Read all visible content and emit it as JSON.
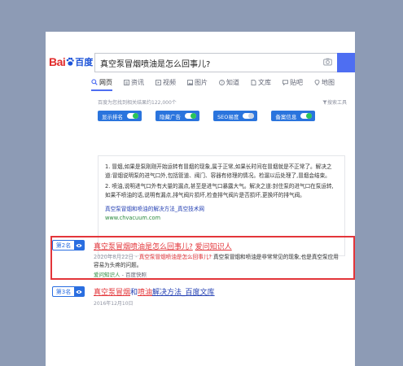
{
  "logo": {
    "part1": "Bai",
    "part2": "百度"
  },
  "search": {
    "query": "真空泵冒烟喷油是怎么回事儿?"
  },
  "tabs": [
    {
      "label": "网页",
      "icon": "search-icon",
      "active": true
    },
    {
      "label": "资讯",
      "icon": "news-icon"
    },
    {
      "label": "视频",
      "icon": "video-icon"
    },
    {
      "label": "图片",
      "icon": "image-icon"
    },
    {
      "label": "知道",
      "icon": "question-icon"
    },
    {
      "label": "文库",
      "icon": "document-icon"
    },
    {
      "label": "贴吧",
      "icon": "forum-icon"
    },
    {
      "label": "地图",
      "icon": "map-icon"
    }
  ],
  "meta": {
    "results_text": "百度为您找到相关结果约122,000个",
    "tools_label": "搜索工具"
  },
  "toggles": [
    {
      "label": "显示排名",
      "state": "on"
    },
    {
      "label": "隐藏广告",
      "state": "on"
    },
    {
      "label": "SEO易度",
      "state": "off"
    },
    {
      "label": "备案信息",
      "state": "on"
    }
  ],
  "answer_card": {
    "point1": "1. 冒烟,如果是泵刚刚开始运转有冒烟的现象,属于正常,如果长时间在冒烟就是不正常了。解决之道:冒烟说明泵的进气口外,包括管道、阀门、容器有修理的情况。检漏以后处理了,冒烟会结束。",
    "point2": "2. 喷油,说明进气口外有大量的漏点,甚至是进气口暴露大气。解决之道:封住泵的进气口在泵运转,如果不喷油的话,说明有漏点,排气阀片损坏,检查排气阀片是否损坏,更换坏的排气阀。",
    "source_title": "真空泵冒烟和喷油的解决方法_真空技术网",
    "source_url": "www.chvacuum.com"
  },
  "results": [
    {
      "rank": "第2名",
      "title_hl": "真空泵冒烟喷油是怎么回事儿?",
      "title_sep": " ",
      "title_site": "爱问知识人",
      "date": "2020年8月22日 - ",
      "snippet_hl": "真空泵冒烟喷油是怎么回事儿?",
      "snippet_rest": " 真空泵冒烟和喷油是非常常见的现象,也是真空泵应用容易为头疼的问题。",
      "site": "爱问知识人",
      "site_aux": " - 百度快照"
    },
    {
      "rank": "第3名",
      "title_hl": "真空泵冒烟",
      "title_mid": "和",
      "title_hl2": "喷油",
      "title_site": "解决方法_百度文库",
      "meta": "2016年12月10日"
    }
  ]
}
